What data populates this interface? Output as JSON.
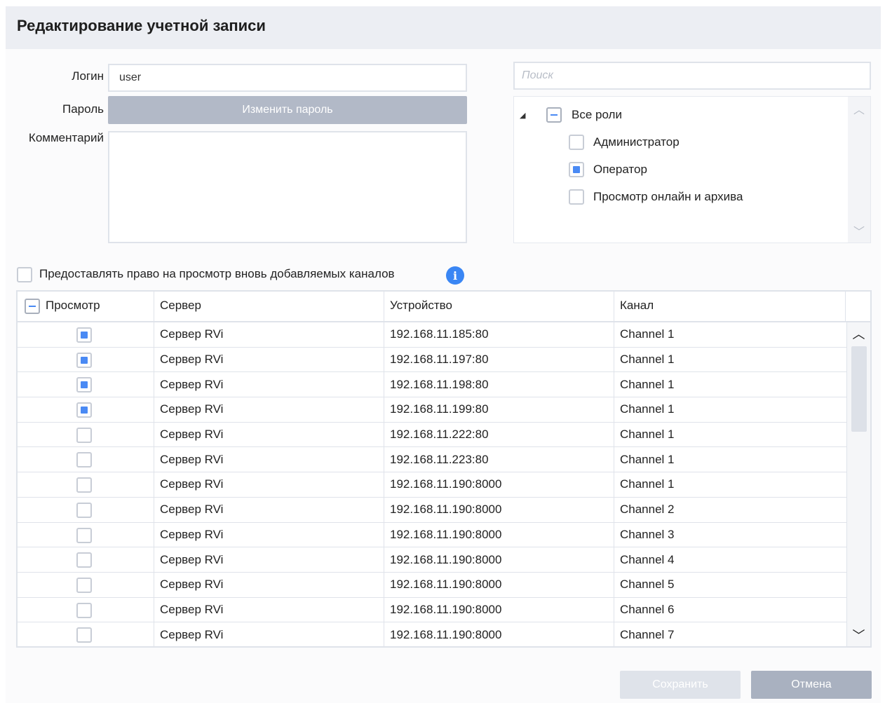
{
  "dialog": {
    "title": "Редактирование учетной записи"
  },
  "form": {
    "login_label": "Логин",
    "login_value": "user",
    "password_label": "Пароль",
    "change_password_label": "Изменить пароль",
    "comment_label": "Комментарий",
    "comment_value": ""
  },
  "roles": {
    "search_placeholder": "Поиск",
    "all_roles_label": "Все роли",
    "items": [
      {
        "label": "Администратор",
        "checked": false
      },
      {
        "label": "Оператор",
        "checked": true
      },
      {
        "label": "Просмотр онлайн и архива",
        "checked": false
      }
    ]
  },
  "grant_new_channels": {
    "label": "Предоставлять право на просмотр вновь добавляемых каналов",
    "checked": false
  },
  "table": {
    "headers": {
      "view": "Просмотр",
      "server": "Сервер",
      "device": "Устройство",
      "channel": "Канал"
    },
    "rows": [
      {
        "checked": true,
        "server": "Сервер RVi",
        "device": "192.168.11.185:80",
        "channel": "Channel 1"
      },
      {
        "checked": true,
        "server": "Сервер RVi",
        "device": "192.168.11.197:80",
        "channel": "Channel 1"
      },
      {
        "checked": true,
        "server": "Сервер RVi",
        "device": "192.168.11.198:80",
        "channel": "Channel 1"
      },
      {
        "checked": true,
        "server": "Сервер RVi",
        "device": "192.168.11.199:80",
        "channel": "Channel 1"
      },
      {
        "checked": false,
        "server": "Сервер RVi",
        "device": "192.168.11.222:80",
        "channel": "Channel 1"
      },
      {
        "checked": false,
        "server": "Сервер RVi",
        "device": "192.168.11.223:80",
        "channel": "Channel 1"
      },
      {
        "checked": false,
        "server": "Сервер RVi",
        "device": "192.168.11.190:8000",
        "channel": "Channel 1"
      },
      {
        "checked": false,
        "server": "Сервер RVi",
        "device": "192.168.11.190:8000",
        "channel": "Channel 2"
      },
      {
        "checked": false,
        "server": "Сервер RVi",
        "device": "192.168.11.190:8000",
        "channel": "Channel 3"
      },
      {
        "checked": false,
        "server": "Сервер RVi",
        "device": "192.168.11.190:8000",
        "channel": "Channel 4"
      },
      {
        "checked": false,
        "server": "Сервер RVi",
        "device": "192.168.11.190:8000",
        "channel": "Channel 5"
      },
      {
        "checked": false,
        "server": "Сервер RVi",
        "device": "192.168.11.190:8000",
        "channel": "Channel 6"
      },
      {
        "checked": false,
        "server": "Сервер RVi",
        "device": "192.168.11.190:8000",
        "channel": "Channel 7"
      }
    ]
  },
  "buttons": {
    "save": "Сохранить",
    "cancel": "Отмена"
  },
  "colors": {
    "accent": "#4a8af4",
    "header_bg": "#eceef3",
    "button_disabled": "#dfe3ea",
    "button_cancel": "#a9b1c0"
  }
}
